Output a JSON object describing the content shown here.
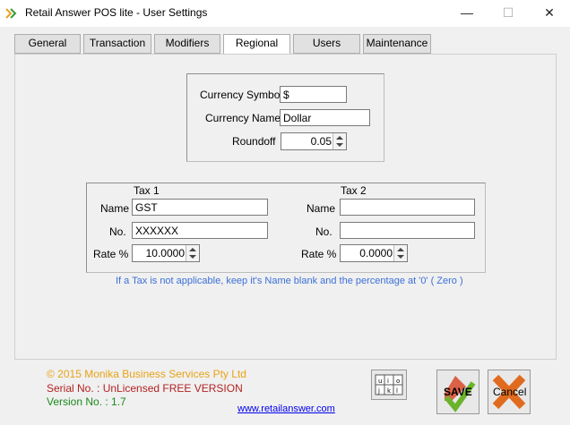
{
  "window": {
    "title": "Retail Answer POS lite - User Settings",
    "minimize_glyph": "—",
    "maximize_glyph": "☐",
    "close_glyph": "✕"
  },
  "tabs": [
    {
      "label": "General"
    },
    {
      "label": "Transaction"
    },
    {
      "label": "Modifiers"
    },
    {
      "label": "Regional",
      "active": true
    },
    {
      "label": "Users"
    },
    {
      "label": "Maintenance"
    }
  ],
  "currency": {
    "symbol_label": "Currency Symbol",
    "symbol_value": "$",
    "name_label": "Currency Name",
    "name_value": "Dollar",
    "roundoff_label": "Roundoff",
    "roundoff_value": "0.05"
  },
  "tax1": {
    "header": "Tax 1",
    "name_label": "Name",
    "name_value": "GST",
    "no_label": "No.",
    "no_value": "XXXXXX",
    "rate_label": "Rate %",
    "rate_value": "10.0000"
  },
  "tax2": {
    "header": "Tax 2",
    "name_label": "Name",
    "name_value": "",
    "no_label": "No.",
    "no_value": "",
    "rate_label": "Rate %",
    "rate_value": "0.0000"
  },
  "note": "If a Tax is not applicable, keep it's Name blank and the percentage at '0' ( Zero )",
  "footer": {
    "copyright": "© 2015 Monika Business Services Pty Ltd",
    "serial": "Serial No. : UnLicensed FREE VERSION",
    "version": "Version No. : 1.7",
    "link": "www.retailanswer.com"
  },
  "buttons": {
    "save": "SAVE",
    "cancel": "Cancel"
  },
  "colors": {
    "copyright": "#e8a317",
    "serial": "#b22222",
    "version": "#1a8a1a",
    "note": "#3c6fd8",
    "save_pencil": "#d94a2a",
    "save_check": "#6ab42b",
    "cancel_x": "#e06b1e"
  },
  "keyboard_icon_keys": [
    "u",
    "i",
    "o",
    "j",
    "k",
    "l"
  ]
}
